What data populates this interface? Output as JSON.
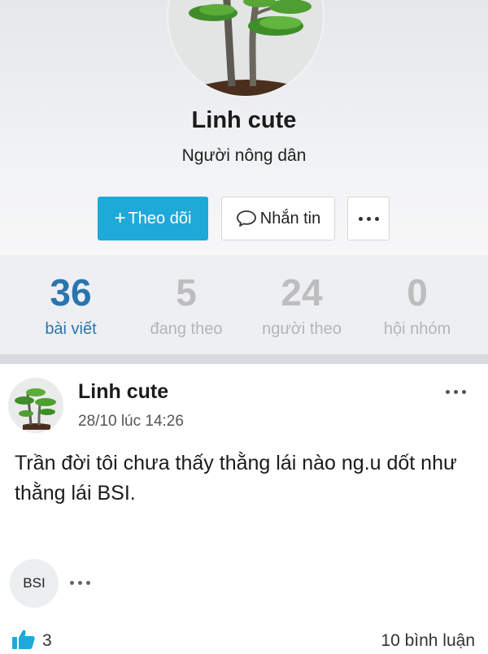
{
  "profile": {
    "name": "Linh cute",
    "subtitle": "Người nông dân",
    "follow_button": "Theo dõi",
    "message_button": "Nhắn tin"
  },
  "stats": [
    {
      "value": "36",
      "label": "bài viết"
    },
    {
      "value": "5",
      "label": "đang theo"
    },
    {
      "value": "24",
      "label": "người theo"
    },
    {
      "value": "0",
      "label": "hội nhóm"
    }
  ],
  "post": {
    "author": "Linh cute",
    "time": "28/10 lúc 14:26",
    "text": "Trần đời tôi chưa thấy thằng lái nào ng.u dốt như thằng lái BSI.",
    "tag": "BSI",
    "likes": "3",
    "comments": "10 bình luận"
  },
  "colors": {
    "accent": "#1fa9d8",
    "active_stat": "#2a75ad",
    "inactive_stat": "#bdbdbd",
    "like": "#1fa9d8"
  },
  "icons": {
    "follow": "plus-icon",
    "message": "speech-bubble-icon",
    "more": "more-dots-icon",
    "like": "thumbs-up-icon"
  }
}
